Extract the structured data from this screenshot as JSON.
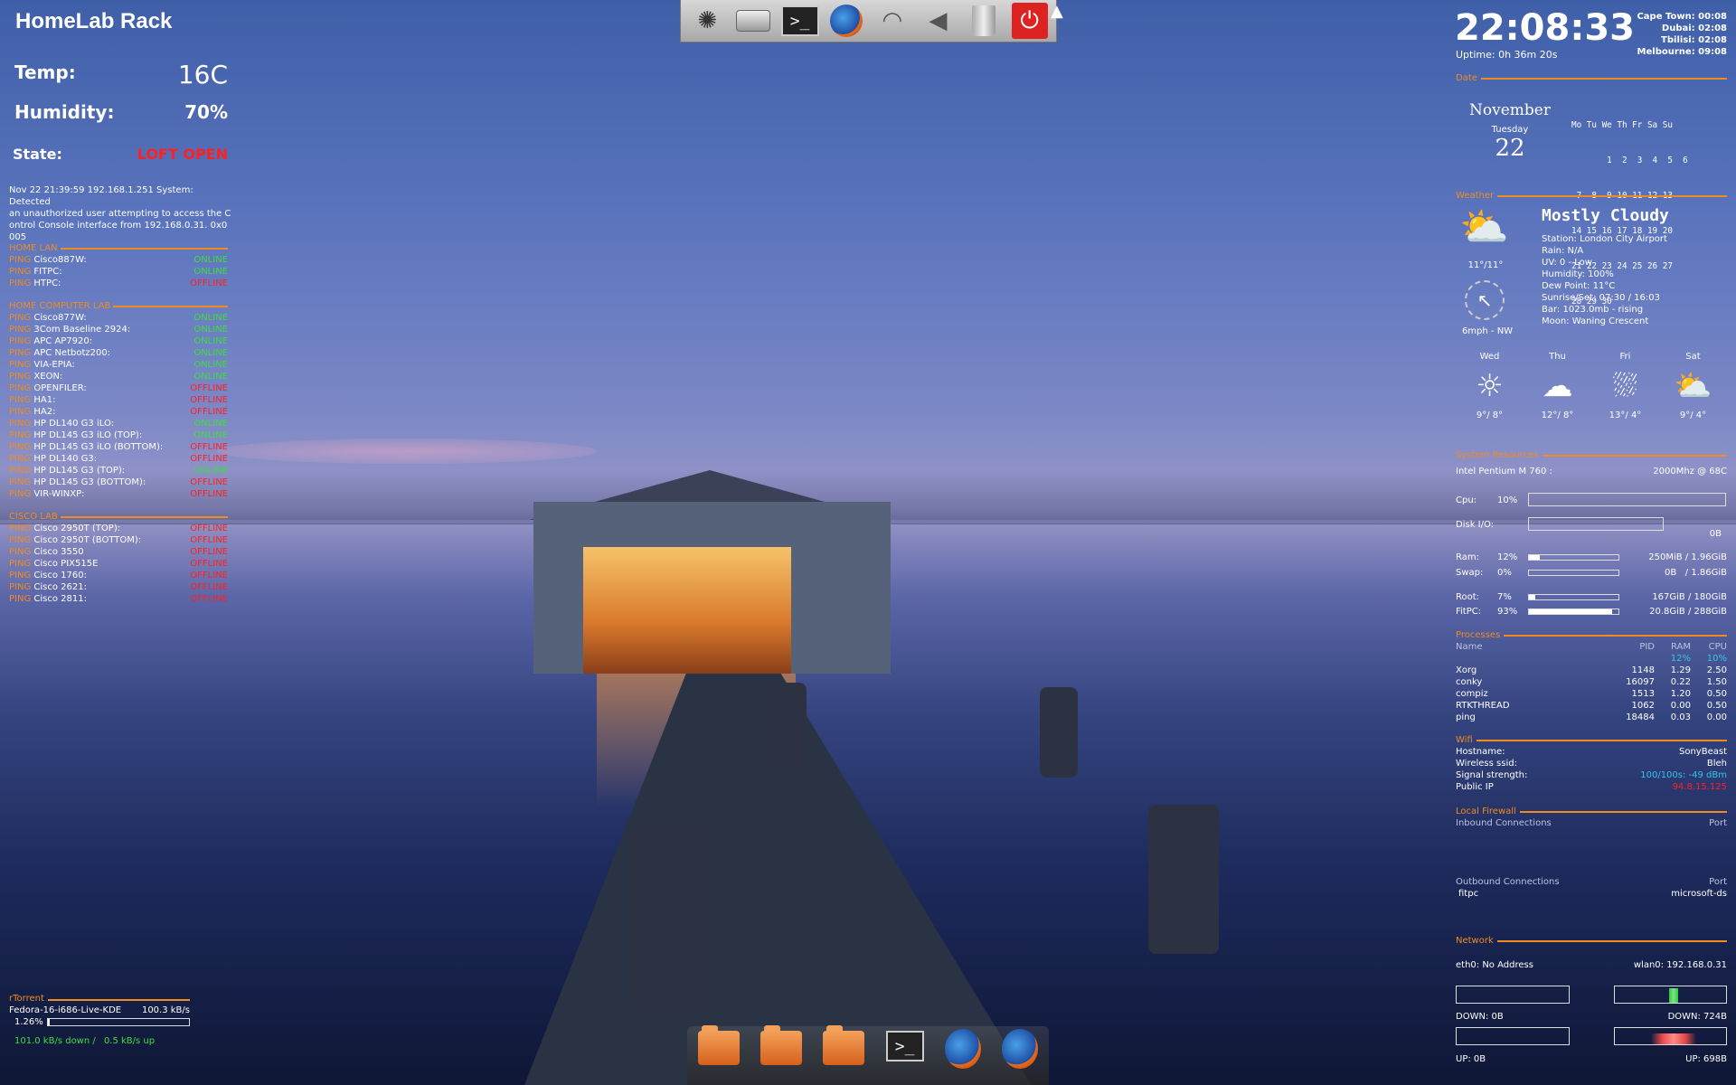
{
  "left": {
    "title": "HomeLab Rack",
    "temp_label": "Temp:",
    "temp_value": "16C",
    "humidity_label": "Humidity:",
    "humidity_value": "70%",
    "state_label": "State:",
    "state_value": "LOFT OPEN",
    "log": [
      "Nov 22 21:39:59 192.168.1.251 System: Detected",
      "an unauthorized user attempting to access the C",
      "ontrol Console interface from 192.168.0.31. 0x0",
      "005"
    ],
    "sections": [
      {
        "title": "HOME LAN",
        "rows": [
          {
            "host": "Cisco887W:",
            "status": "ONLINE"
          },
          {
            "host": "FITPC:",
            "status": "ONLINE"
          },
          {
            "host": "HTPC:",
            "status": "OFFLINE"
          }
        ]
      },
      {
        "title": "HOME COMPUTER LAB",
        "rows": [
          {
            "host": "Cisco877W:",
            "status": "ONLINE"
          },
          {
            "host": "3Com Baseline 2924:",
            "status": "ONLINE"
          },
          {
            "host": "APC AP7920:",
            "status": "ONLINE"
          },
          {
            "host": "APC Netbotz200:",
            "status": "ONLINE"
          },
          {
            "host": "VIA-EPIA:",
            "status": "ONLINE"
          },
          {
            "host": "XEON:",
            "status": "ONLINE"
          },
          {
            "host": "OPENFILER:",
            "status": "OFFLINE"
          },
          {
            "host": "HA1:",
            "status": "OFFLINE"
          },
          {
            "host": "HA2:",
            "status": "OFFLINE"
          },
          {
            "host": "HP DL140 G3 iLO:",
            "status": "ONLINE"
          },
          {
            "host": "HP DL145 G3 iLO (TOP):",
            "status": "ONLINE"
          },
          {
            "host": "HP DL145 G3 iLO (BOTTOM):",
            "status": "OFFLINE"
          },
          {
            "host": "HP DL140 G3:",
            "status": "OFFLINE"
          },
          {
            "host": "HP DL145 G3 (TOP):",
            "status": "ONLINE"
          },
          {
            "host": "HP DL145 G3 (BOTTOM):",
            "status": "OFFLINE"
          },
          {
            "host": "VIR-WINXP:",
            "status": "OFFLINE"
          }
        ]
      },
      {
        "title": "CISCO LAB",
        "rows": [
          {
            "host": "Cisco 2950T (TOP):",
            "status": "OFFLINE"
          },
          {
            "host": "Cisco 2950T (BOTTOM):",
            "status": "OFFLINE"
          },
          {
            "host": "Cisco 3550",
            "status": "OFFLINE"
          },
          {
            "host": "Cisco PIX515E",
            "status": "OFFLINE"
          },
          {
            "host": "Cisco 1760:",
            "status": "OFFLINE"
          },
          {
            "host": "Cisco 2621:",
            "status": "OFFLINE"
          },
          {
            "host": "Cisco 2811:",
            "status": "OFFLINE"
          }
        ]
      }
    ],
    "ping_label": "PING",
    "rtorrent_title": "rTorrent",
    "torrent_name": "Fedora-16-i686-Live-KDE",
    "torrent_speed": "100.3 kB/s",
    "torrent_pct": "1.26%",
    "torrent_progress": 1.26,
    "torrent_down": "101.0 kB/s down /",
    "torrent_up": "0.5 kB/s up"
  },
  "right": {
    "time": "22:08:33",
    "uptime": "Uptime: 0h 36m 20s",
    "zones": [
      "Cape Town: 00:08",
      "Dubai: 02:08",
      "Tbilisi: 02:08",
      "Melbourne: 09:08"
    ],
    "date_title": "Date",
    "month": "November",
    "weekday": "Tuesday",
    "day": "22",
    "cal_header": "Mo Tu We Th Fr Sa Su",
    "cal_rows": [
      "       1  2  3  4  5  6",
      " 7  8  9 10 11 12 13",
      "14 15 16 17 18 19 20",
      "21 22 23 24 25 26 27",
      "28 29 30"
    ],
    "weather_title": "Weather",
    "condition": "Mostly Cloudy",
    "temp_now": "11°/11°",
    "wind": "6mph - NW",
    "weather_lines": [
      "Station: London City Airport",
      "Rain: N/A",
      "UV: 0 - Low",
      "Humidity: 100%",
      "Dew Point: 11°C",
      "Sunrise/Set: 07:30 / 16:03",
      "Bar: 1023.0mb - rising",
      "Moon: Waning Crescent"
    ],
    "forecast": [
      {
        "day": "Wed",
        "temp": "9°/ 8°",
        "icon": "sun-icon"
      },
      {
        "day": "Thu",
        "temp": "12°/ 8°",
        "icon": "cloud-icon"
      },
      {
        "day": "Fri",
        "temp": "13°/ 4°",
        "icon": "rain-icon"
      },
      {
        "day": "Sat",
        "temp": "9°/ 4°",
        "icon": "partly-cloudy-icon"
      }
    ],
    "sys_title": "System Resources",
    "cpu_name": "Intel Pentium M 760 :",
    "cpu_freq": "2000Mhz @ 68C",
    "cpu_label": "Cpu:",
    "cpu_pct": "10%",
    "disk_label": "Disk I/O:",
    "disk_val": "0B",
    "ram_label": "Ram:",
    "ram_pct": "12%",
    "ram_val": "250MiB / 1.96GiB",
    "ram_level": 12,
    "swap_label": "Swap:",
    "swap_pct": "0%",
    "swap_val": "0B   / 1.86GiB",
    "swap_level": 0,
    "root_label": "Root:",
    "root_pct": "7%",
    "root_val": "167GiB / 180GiB",
    "root_level": 7,
    "fitpc_label": "FitPC:",
    "fitpc_pct": "93%",
    "fitpc_val": "20.8GiB / 288GiB",
    "fitpc_level": 93,
    "proc_title": "Processes",
    "proc_headers": [
      "Name",
      "PID",
      "RAM",
      "CPU"
    ],
    "proc_totals": [
      "12%",
      "10%"
    ],
    "procs": [
      [
        "Xorg",
        "1148",
        "1.29",
        "2.50"
      ],
      [
        "conky",
        "16097",
        "0.22",
        "1.50"
      ],
      [
        "compiz",
        "1513",
        "1.20",
        "0.50"
      ],
      [
        "RTKTHREAD",
        "1062",
        "0.00",
        "0.50"
      ],
      [
        "ping",
        "18484",
        "0.03",
        "0.00"
      ]
    ],
    "wifi_title": "Wifi",
    "wifi_rows": [
      [
        "Hostname:",
        "SonyBeast"
      ],
      [
        "Wireless ssid:",
        "Bleh"
      ],
      [
        "Signal strength:",
        "100/100s: -49 dBm"
      ],
      [
        "Public IP",
        "94.8.15.125"
      ]
    ],
    "fw_title": "Local Firewall",
    "fw_in": "Inbound Connections",
    "fw_port": "Port",
    "fw_out": "Outbound Connections",
    "fw_out_host": "fitpc",
    "fw_out_port": "microsoft-ds",
    "net_title": "Network",
    "eth0": "eth0: No Address",
    "wlan0": "wlan0: 192.168.0.31",
    "eth_down": "DOWN: 0B",
    "wlan_down": "DOWN: 724B",
    "eth_up": "UP: 0B",
    "wlan_up": "UP: 698B"
  },
  "dock_top": [
    "ubuntu-logo-icon",
    "drive-icon",
    "terminal-icon",
    "firefox-icon",
    "wifi-icon",
    "volume-icon",
    "trash-icon",
    "power-icon"
  ],
  "dock_bottom": [
    "home-folder-icon",
    "home-folder-icon",
    "home-folder-icon",
    "terminal-icon",
    "firefox-icon",
    "firefox-icon"
  ],
  "terminal_glyph": ">_",
  "colors": {
    "accent": "#ef8b21",
    "online": "#3dde3d",
    "offline": "#ff2020",
    "info": "#33c5e8"
  }
}
